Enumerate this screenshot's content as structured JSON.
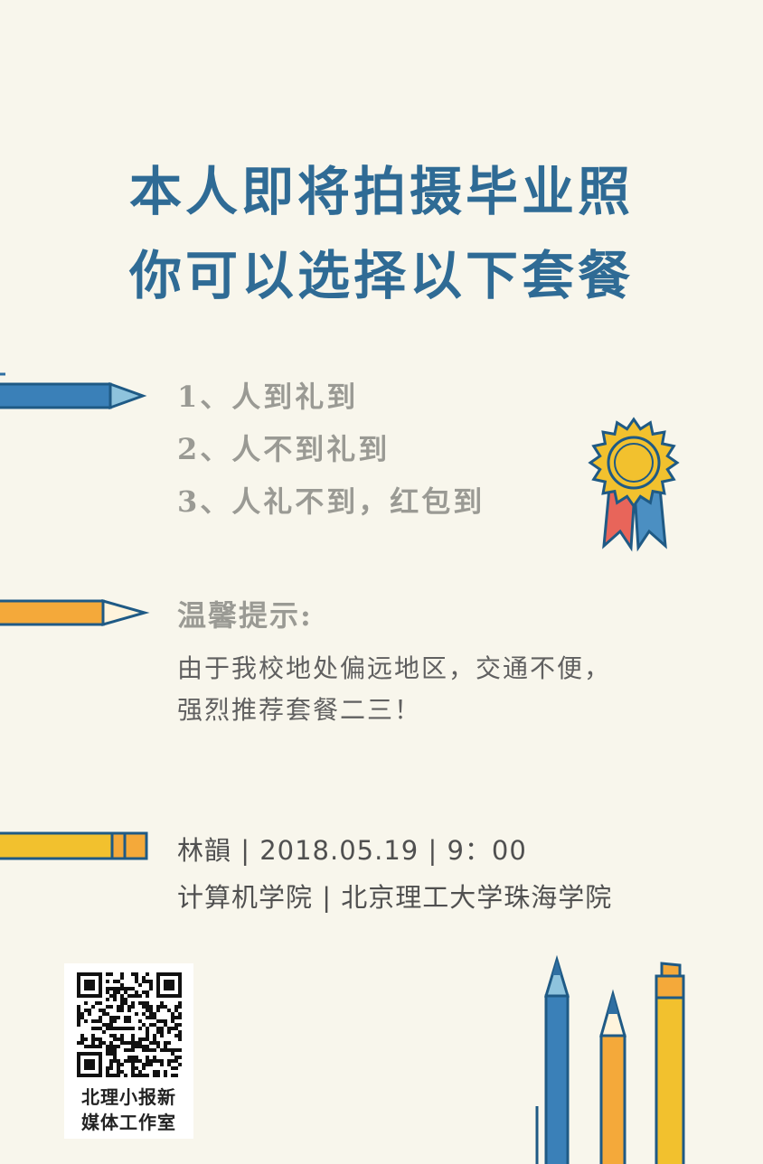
{
  "title": [
    "本人即将拍摄毕业照",
    "你可以选择以下套餐"
  ],
  "packages": [
    "1、人到礼到",
    "2、人不到礼到",
    "3、人礼不到，红包到"
  ],
  "tip": {
    "title": "温馨提示:",
    "lines": [
      "由于我校地处偏远地区，交通不便，",
      "强烈推荐套餐二三！"
    ]
  },
  "info": [
    "林韻 | 2018.05.19 | 9：00",
    "计算机学院 | 北京理工大学珠海学院"
  ],
  "qr": {
    "caption": [
      "北理小报新",
      "媒体工作室"
    ]
  },
  "colors": {
    "title": "#2f6b95",
    "background": "#f8f6ec",
    "blue": "#2f6fa2",
    "orange": "#f4a93a",
    "yellow": "#f2c12e",
    "red": "#e8655a"
  },
  "icons": [
    "pencil-blue-icon",
    "pencil-orange-icon",
    "pencil-yellow-icon",
    "medal-ribbon-icon",
    "qr-code-icon",
    "pencils-group-icon"
  ]
}
